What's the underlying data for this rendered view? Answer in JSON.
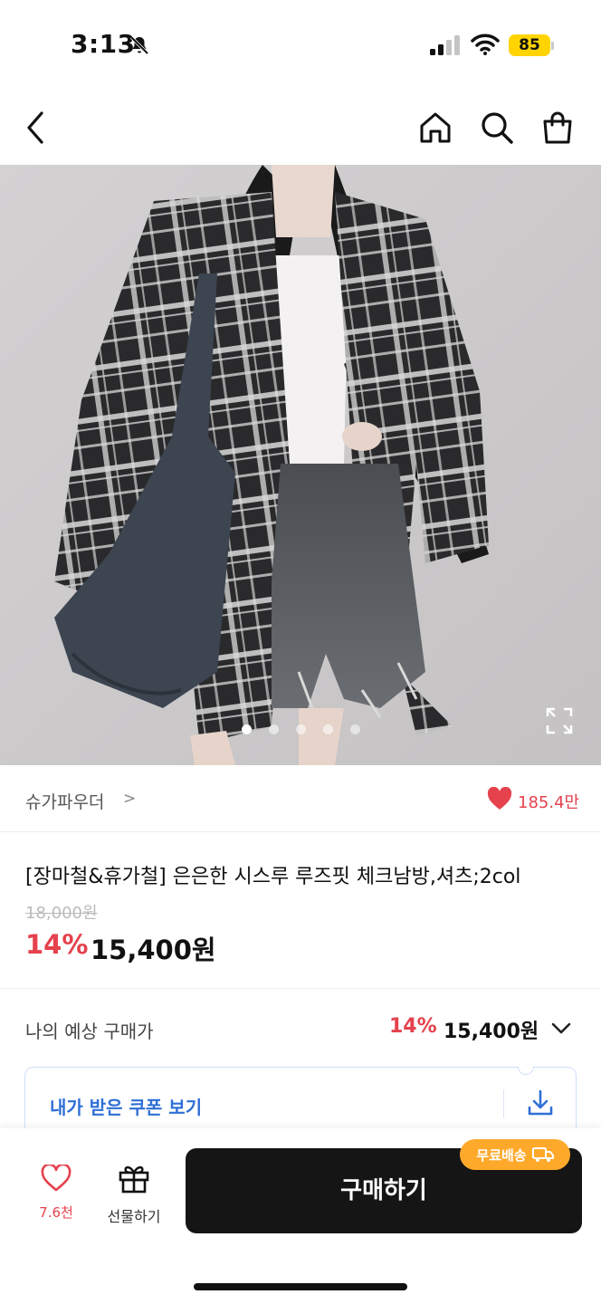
{
  "status_bar": {
    "time": "3:13",
    "battery": "85"
  },
  "nav": {
    "back_icon": "chevron-left-icon",
    "home_icon": "home-icon",
    "search_icon": "search-icon",
    "cart_icon": "shopping-bag-icon"
  },
  "gallery": {
    "total_images": 5,
    "active_index": 0
  },
  "store": {
    "name": "슈가파우더",
    "chevron": ">",
    "likes": "185.4만"
  },
  "product": {
    "title": "[장마철&휴가철] 은은한 시스루 루즈핏 체크남방,셔츠;2col",
    "original_price": "18,000원",
    "discount": "14%",
    "price": "15,400원"
  },
  "expected": {
    "label": "나의 예상 구매가",
    "discount": "14%",
    "price": "15,400원"
  },
  "coupon": {
    "label": "내가 받은 쿠폰 보기"
  },
  "bottom": {
    "wish_count": "7.6천",
    "gift_label": "선물하기",
    "buy_label": "구매하기",
    "free_shipping": "무료배송"
  },
  "colors": {
    "accent": "#e5424d",
    "coupon_blue": "#2f6fd6",
    "badge_orange": "#ffa92b",
    "buy_bg": "#151515"
  }
}
